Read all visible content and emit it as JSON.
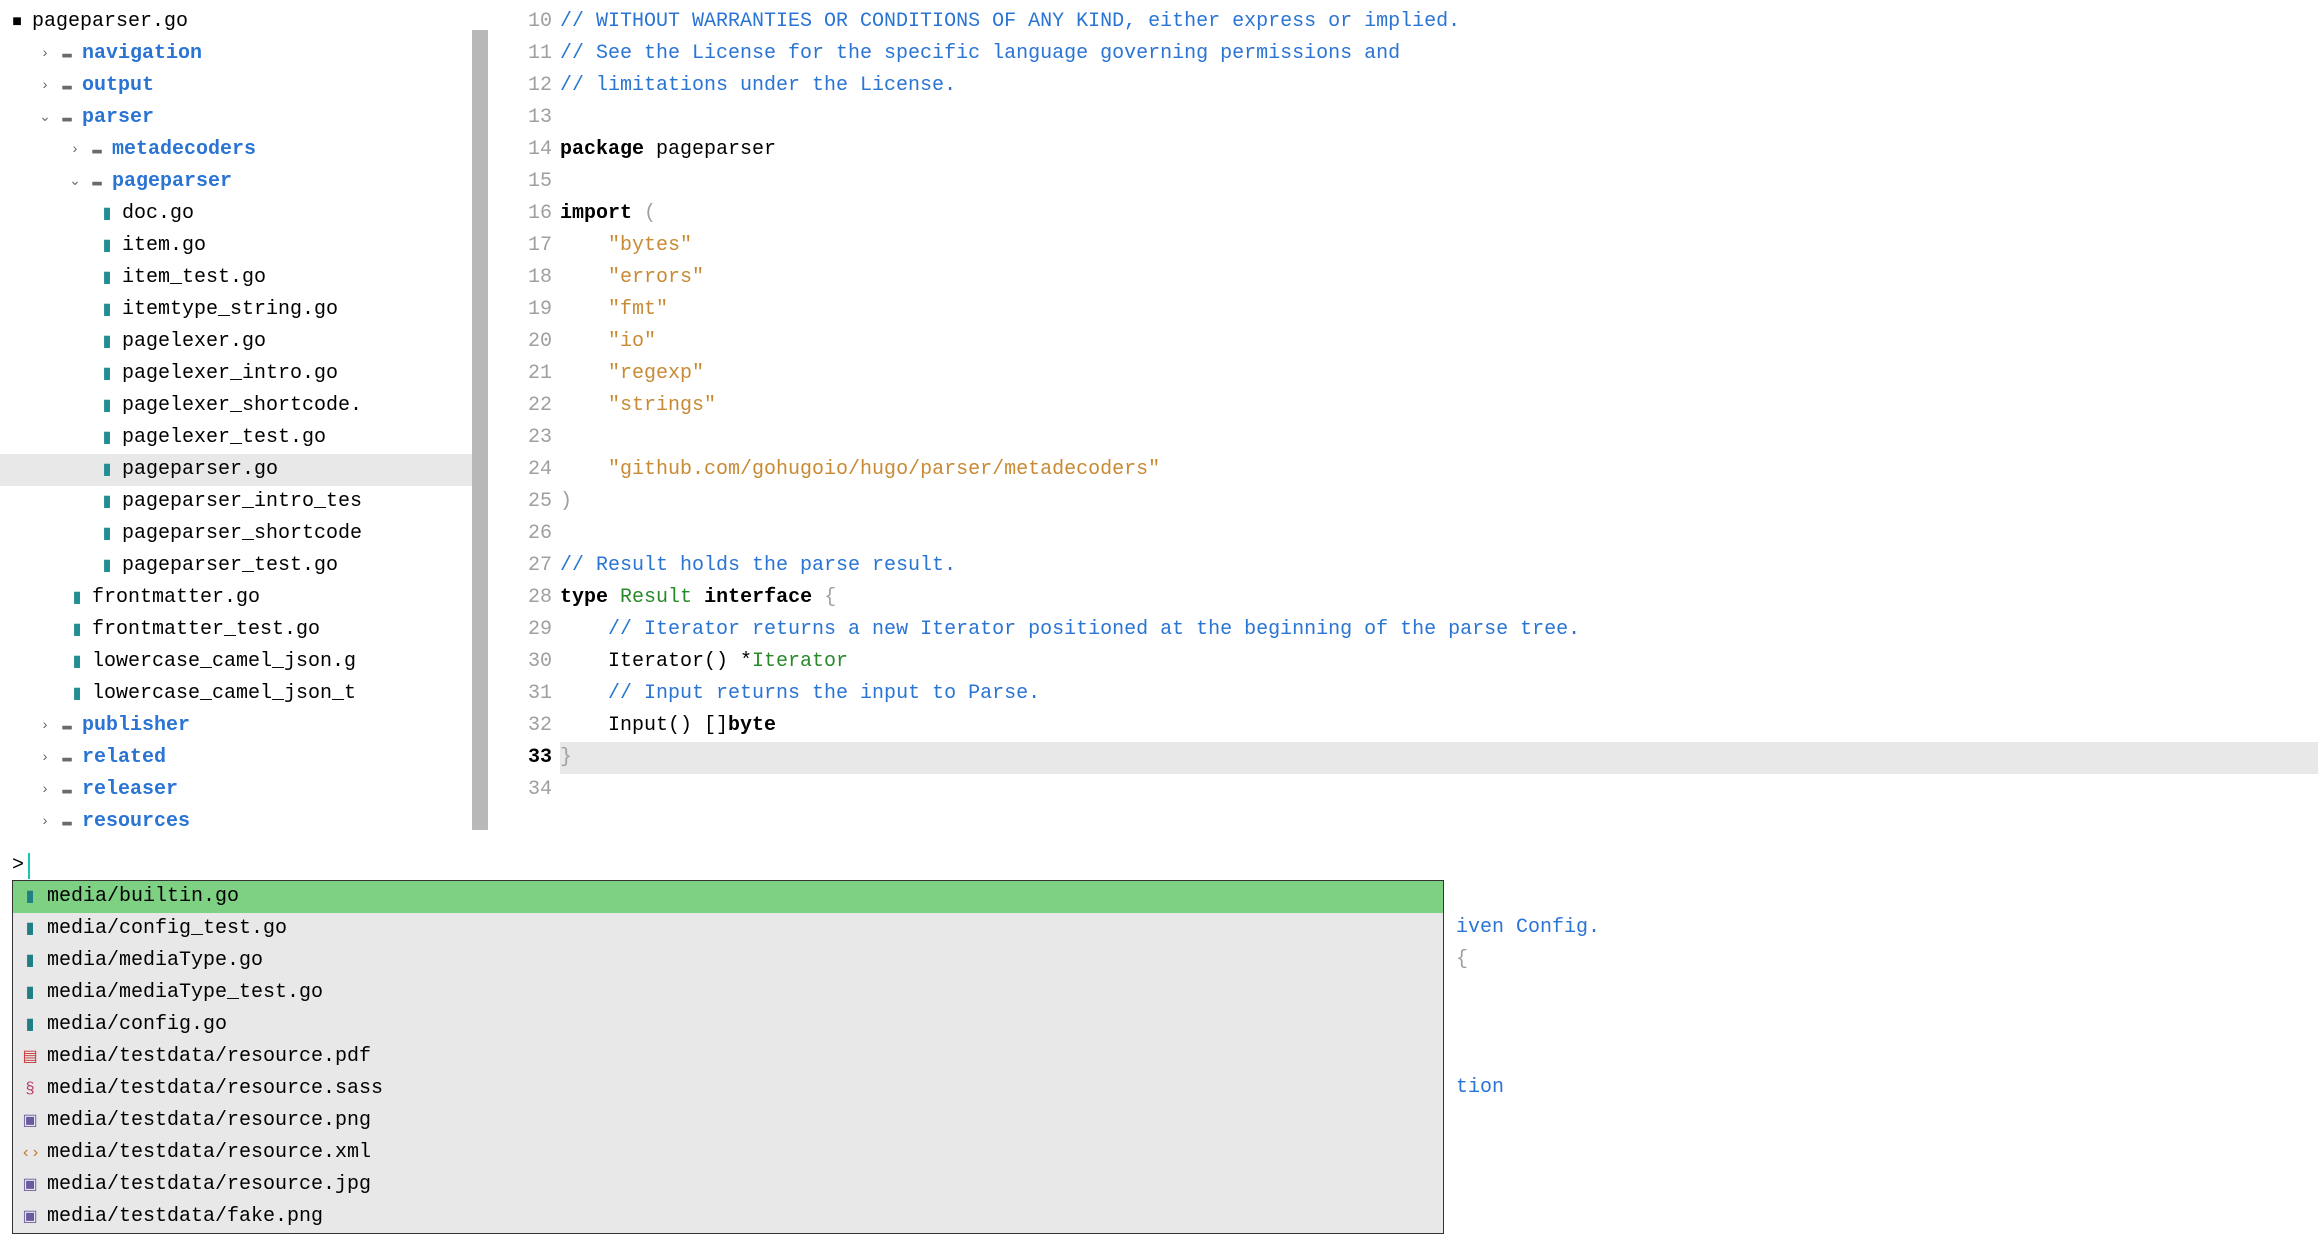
{
  "active_file": "pageparser.go",
  "sidebar": {
    "root_icon": "■",
    "root": "pageparser.go",
    "items": [
      {
        "kind": "folder",
        "label": "navigation",
        "indent": 1,
        "chev": "›"
      },
      {
        "kind": "folder",
        "label": "output",
        "indent": 1,
        "chev": "›"
      },
      {
        "kind": "folder",
        "label": "parser",
        "indent": 1,
        "chev": "⌄",
        "open": true
      },
      {
        "kind": "folder",
        "label": "metadecoders",
        "indent": 2,
        "chev": "›"
      },
      {
        "kind": "folder",
        "label": "pageparser",
        "indent": 2,
        "chev": "⌄",
        "open": true
      },
      {
        "kind": "file",
        "label": "doc.go",
        "indent": 3
      },
      {
        "kind": "file",
        "label": "item.go",
        "indent": 3
      },
      {
        "kind": "file",
        "label": "item_test.go",
        "indent": 3
      },
      {
        "kind": "file",
        "label": "itemtype_string.go",
        "indent": 3
      },
      {
        "kind": "file",
        "label": "pagelexer.go",
        "indent": 3
      },
      {
        "kind": "file",
        "label": "pagelexer_intro.go",
        "indent": 3
      },
      {
        "kind": "file",
        "label": "pagelexer_shortcode.",
        "indent": 3
      },
      {
        "kind": "file",
        "label": "pagelexer_test.go",
        "indent": 3
      },
      {
        "kind": "file",
        "label": "pageparser.go",
        "indent": 3,
        "selected": true
      },
      {
        "kind": "file",
        "label": "pageparser_intro_tes",
        "indent": 3
      },
      {
        "kind": "file",
        "label": "pageparser_shortcode",
        "indent": 3
      },
      {
        "kind": "file",
        "label": "pageparser_test.go",
        "indent": 3
      },
      {
        "kind": "file",
        "label": "frontmatter.go",
        "indent": 2
      },
      {
        "kind": "file",
        "label": "frontmatter_test.go",
        "indent": 2
      },
      {
        "kind": "file",
        "label": "lowercase_camel_json.g",
        "indent": 2
      },
      {
        "kind": "file",
        "label": "lowercase_camel_json_t",
        "indent": 2
      },
      {
        "kind": "folder",
        "label": "publisher",
        "indent": 1,
        "chev": "›"
      },
      {
        "kind": "folder",
        "label": "related",
        "indent": 1,
        "chev": "›"
      },
      {
        "kind": "folder",
        "label": "releaser",
        "indent": 1,
        "chev": "›"
      },
      {
        "kind": "folder",
        "label": "resources",
        "indent": 1,
        "chev": "›"
      }
    ]
  },
  "gutter": {
    "start": 10,
    "end": 34,
    "current": 33
  },
  "code": {
    "lines": [
      [
        {
          "cls": "c-comment",
          "t": "// WITHOUT WARRANTIES OR CONDITIONS OF ANY KIND, either express or implied."
        }
      ],
      [
        {
          "cls": "c-comment",
          "t": "// See the License for the specific language governing permissions and"
        }
      ],
      [
        {
          "cls": "c-comment",
          "t": "// limitations under the License."
        }
      ],
      [],
      [
        {
          "cls": "c-keyword",
          "t": "package"
        },
        {
          "t": " pageparser"
        }
      ],
      [],
      [
        {
          "cls": "c-keyword",
          "t": "import"
        },
        {
          "t": " "
        },
        {
          "cls": "c-punc",
          "t": "("
        }
      ],
      [
        {
          "t": "    "
        },
        {
          "cls": "c-string",
          "t": "\"bytes\""
        }
      ],
      [
        {
          "t": "    "
        },
        {
          "cls": "c-string",
          "t": "\"errors\""
        }
      ],
      [
        {
          "t": "    "
        },
        {
          "cls": "c-string",
          "t": "\"fmt\""
        }
      ],
      [
        {
          "t": "    "
        },
        {
          "cls": "c-string",
          "t": "\"io\""
        }
      ],
      [
        {
          "t": "    "
        },
        {
          "cls": "c-string",
          "t": "\"regexp\""
        }
      ],
      [
        {
          "t": "    "
        },
        {
          "cls": "c-string",
          "t": "\"strings\""
        }
      ],
      [],
      [
        {
          "t": "    "
        },
        {
          "cls": "c-string",
          "t": "\"github.com/gohugoio/hugo/parser/metadecoders\""
        }
      ],
      [
        {
          "cls": "c-punc",
          "t": ")"
        }
      ],
      [],
      [
        {
          "cls": "c-comment",
          "t": "// Result holds the parse result."
        }
      ],
      [
        {
          "cls": "c-keyword",
          "t": "type"
        },
        {
          "t": " "
        },
        {
          "cls": "c-type-dec",
          "t": "Result"
        },
        {
          "t": " "
        },
        {
          "cls": "c-keyword",
          "t": "interface"
        },
        {
          "t": " "
        },
        {
          "cls": "c-punc",
          "t": "{"
        }
      ],
      [
        {
          "t": "    "
        },
        {
          "cls": "c-comment",
          "t": "// Iterator returns a new Iterator positioned at the beginning of the parse tree."
        }
      ],
      [
        {
          "t": "    Iterator() *"
        },
        {
          "cls": "c-type-dec",
          "t": "Iterator"
        }
      ],
      [
        {
          "t": "    "
        },
        {
          "cls": "c-comment",
          "t": "// Input returns the input to Parse."
        }
      ],
      [
        {
          "t": "    Input() []"
        },
        {
          "cls": "c-type",
          "t": "byte"
        }
      ],
      [
        {
          "cls": "c-punc",
          "t": "}"
        }
      ],
      []
    ]
  },
  "finder": {
    "prompt": ">",
    "selected_index": 0,
    "results": [
      {
        "icon": "go",
        "label": "media/builtin.go"
      },
      {
        "icon": "go",
        "label": "media/config_test.go"
      },
      {
        "icon": "go",
        "label": "media/mediaType.go"
      },
      {
        "icon": "go",
        "label": "media/mediaType_test.go"
      },
      {
        "icon": "go",
        "label": "media/config.go"
      },
      {
        "icon": "pdf",
        "label": "media/testdata/resource.pdf"
      },
      {
        "icon": "sass",
        "label": "media/testdata/resource.sass"
      },
      {
        "icon": "img",
        "label": "media/testdata/resource.png"
      },
      {
        "icon": "xml",
        "label": "media/testdata/resource.xml"
      },
      {
        "icon": "img",
        "label": "media/testdata/resource.jpg"
      },
      {
        "icon": "img",
        "label": "media/testdata/fake.png"
      }
    ]
  },
  "peek": {
    "lines": [
      "",
      [
        {
          "cls": "c-comment",
          "t": "iven Config."
        }
      ],
      [
        {
          "cls": "c-punc",
          "t": "{"
        }
      ],
      "",
      "",
      "",
      [
        {
          "cls": "c-comment",
          "t": "tion"
        }
      ]
    ]
  }
}
